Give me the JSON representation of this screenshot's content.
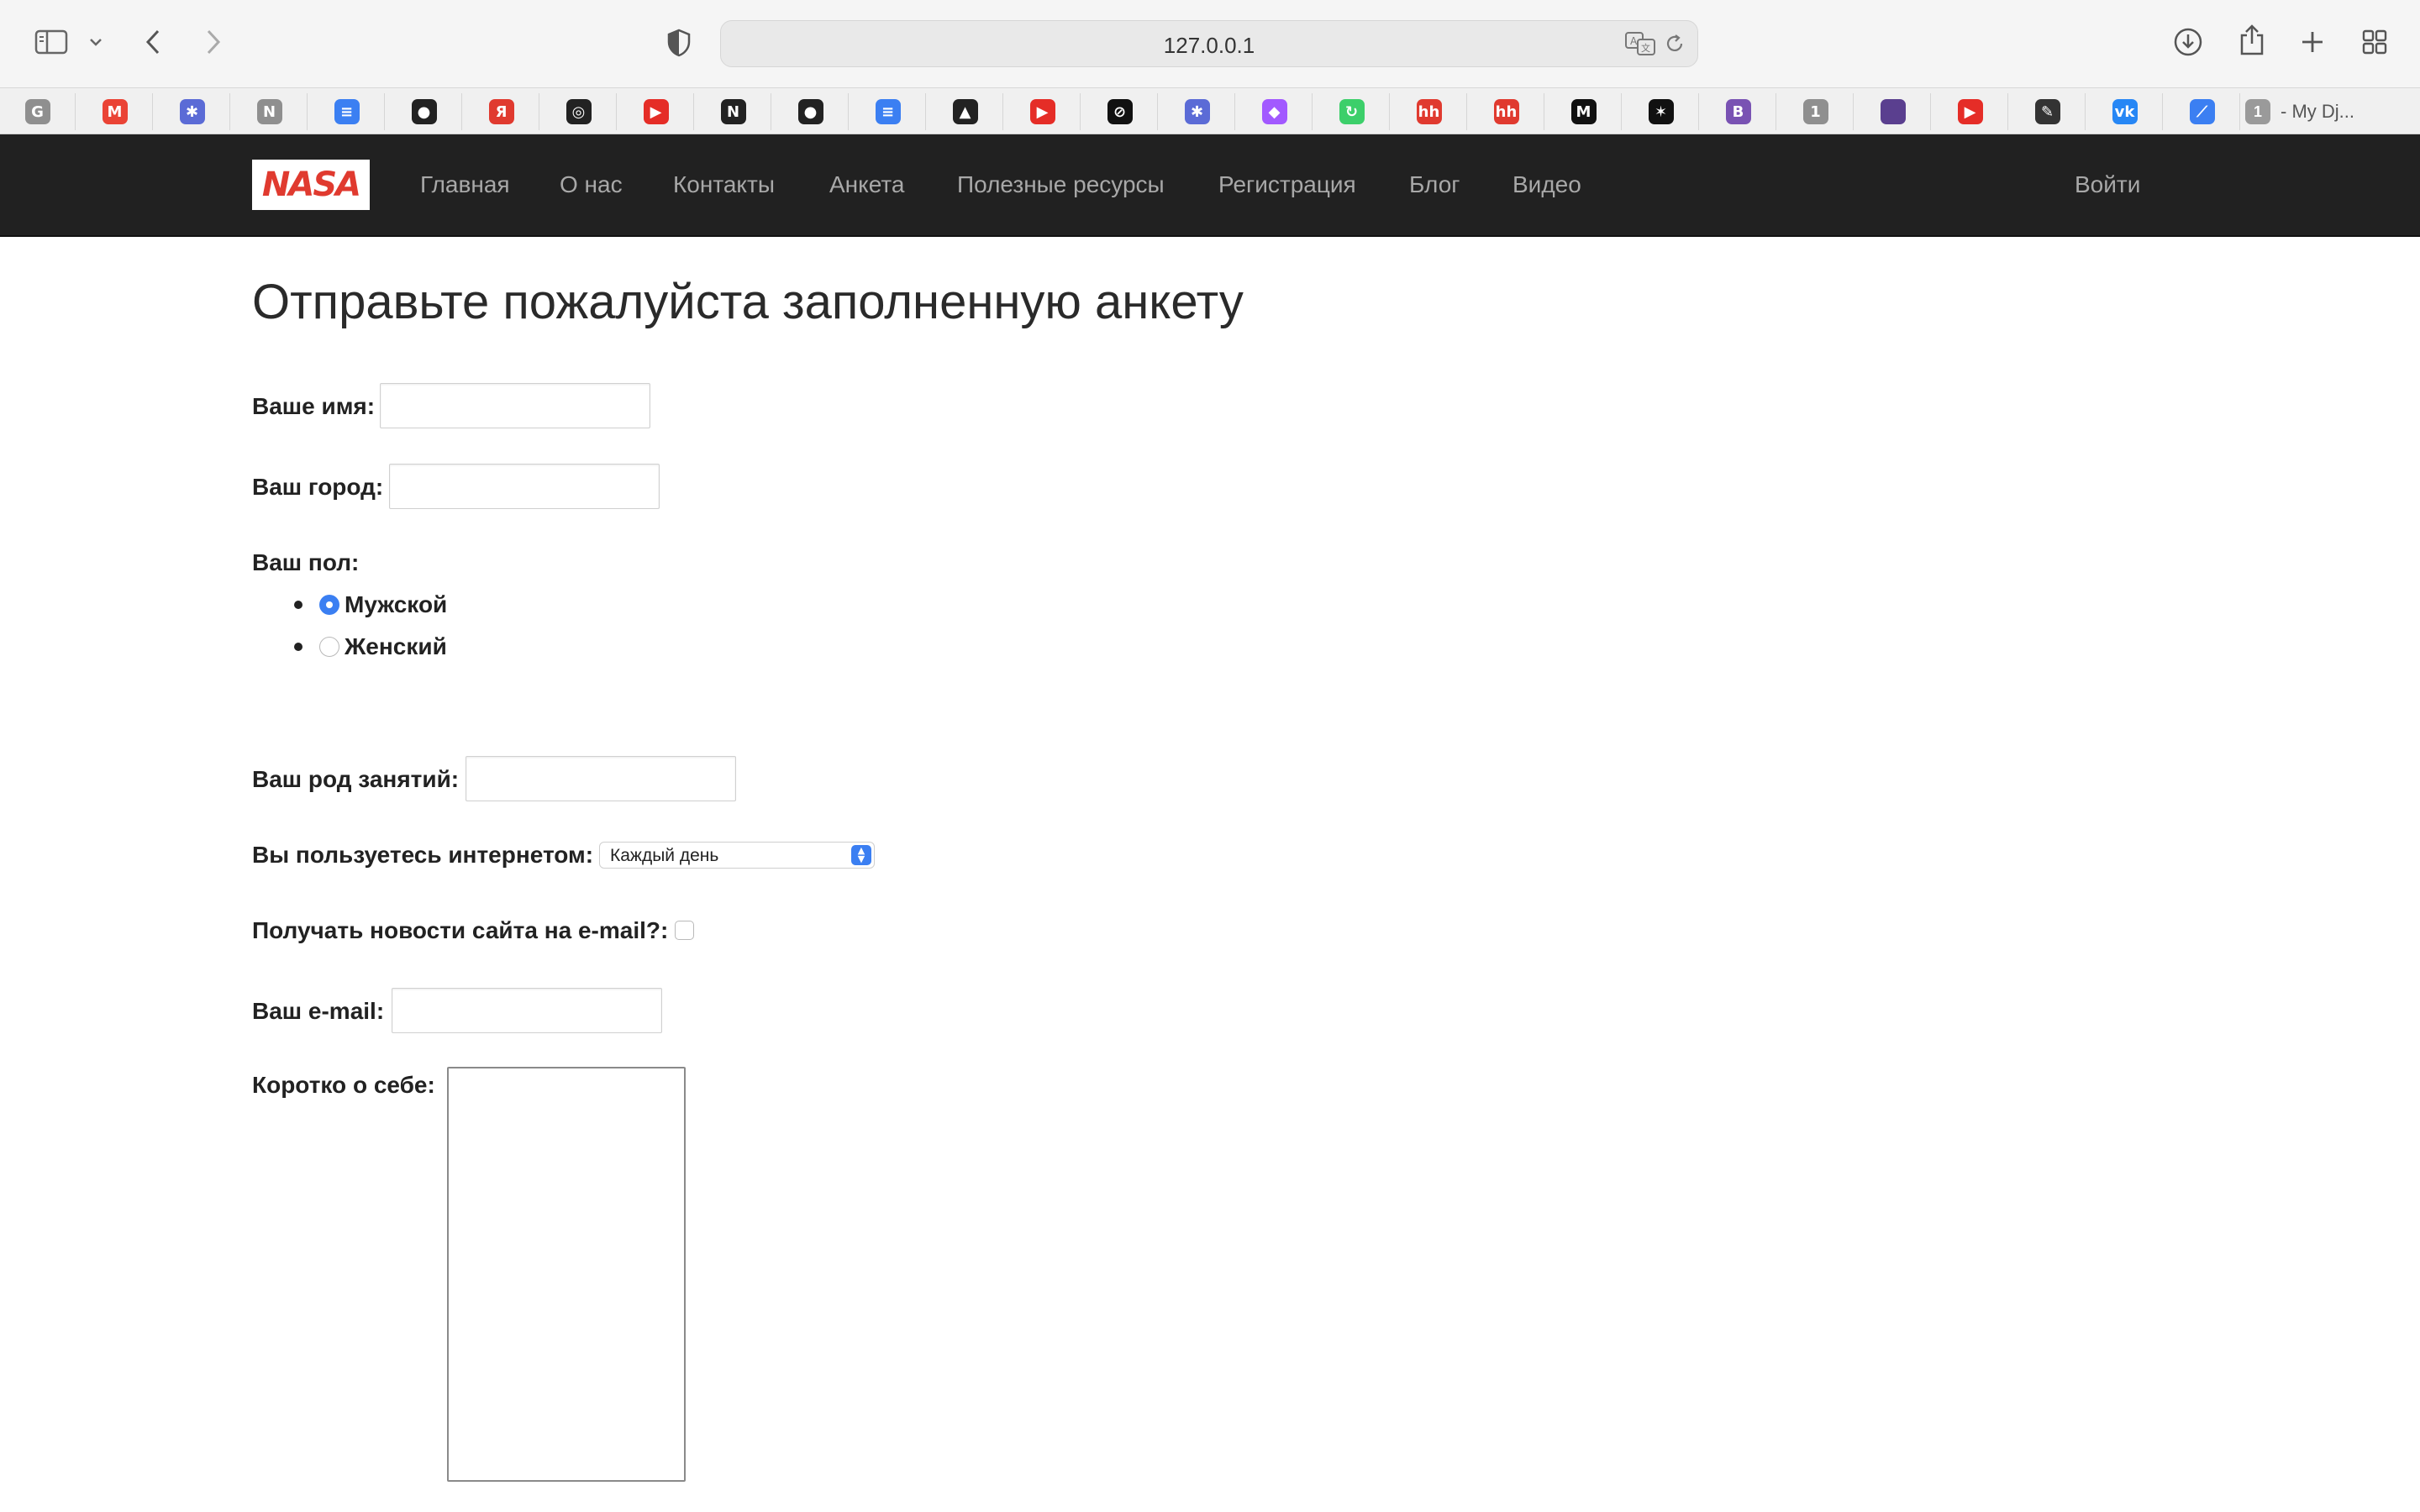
{
  "browser": {
    "url": "127.0.0.1",
    "favorites": [
      {
        "icon": "google-icon",
        "glyph": "G",
        "color": "#8f8f8f"
      },
      {
        "icon": "gmail-icon",
        "glyph": "M",
        "color": "#ea4335"
      },
      {
        "icon": "extension-icon",
        "glyph": "✱",
        "color": "#5b6bd6"
      },
      {
        "icon": "notion-n-icon",
        "glyph": "N",
        "color": "#8f8f8f"
      },
      {
        "icon": "google-docs-icon",
        "glyph": "≡",
        "color": "#3b7ff2"
      },
      {
        "icon": "github-icon",
        "glyph": "●",
        "color": "#222222"
      },
      {
        "icon": "yandex-icon",
        "glyph": "Я",
        "color": "#e03a2f"
      },
      {
        "icon": "chatgpt-icon",
        "glyph": "◎",
        "color": "#222222"
      },
      {
        "icon": "youtube-icon",
        "glyph": "▶",
        "color": "#e52d27"
      },
      {
        "icon": "notion-icon",
        "glyph": "N",
        "color": "#222222"
      },
      {
        "icon": "github-icon",
        "glyph": "●",
        "color": "#222222"
      },
      {
        "icon": "google-docs-icon",
        "glyph": "≡",
        "color": "#3b7ff2"
      },
      {
        "icon": "sailboat-icon",
        "glyph": "▲",
        "color": "#222222"
      },
      {
        "icon": "youtube-icon",
        "glyph": "▶",
        "color": "#e52d27"
      },
      {
        "icon": "link-icon",
        "glyph": "⊘",
        "color": "#111111"
      },
      {
        "icon": "extension-icon",
        "glyph": "✱",
        "color": "#5b6bd6"
      },
      {
        "icon": "figma-icon",
        "glyph": "◆",
        "color": "#a259ff"
      },
      {
        "icon": "refresh-green-icon",
        "glyph": "↻",
        "color": "#3ccf6a"
      },
      {
        "icon": "hh-icon",
        "glyph": "hh",
        "color": "#e03a2f"
      },
      {
        "icon": "hh-icon",
        "glyph": "hh",
        "color": "#e03a2f"
      },
      {
        "icon": "m-logo-icon",
        "glyph": "M",
        "color": "#111111"
      },
      {
        "icon": "kinopoisk-icon",
        "glyph": "✶",
        "color": "#111111"
      },
      {
        "icon": "bootstrap-icon",
        "glyph": "B",
        "color": "#7952b3"
      },
      {
        "icon": "number-one-icon",
        "glyph": "1",
        "color": "#8f8f8f"
      },
      {
        "icon": "purple-square-icon",
        "glyph": "",
        "color": "#5a3f8f"
      },
      {
        "icon": "youtube-icon",
        "glyph": "▶",
        "color": "#e52d27"
      },
      {
        "icon": "cat-icon",
        "glyph": "✎",
        "color": "#333333"
      },
      {
        "icon": "vk-icon",
        "glyph": "vk",
        "color": "#2787f5"
      },
      {
        "icon": "feather-icon",
        "glyph": "⟋",
        "color": "#3b7ff2"
      }
    ],
    "open_tab": {
      "icon_glyph": "1",
      "label": "- My Dj..."
    }
  },
  "site": {
    "nav": {
      "logo": "NASA",
      "items": [
        "Главная",
        "О нас",
        "Контакты",
        "Анкета",
        "Полезные ресурсы",
        "Регистрация",
        "Блог",
        "Видео"
      ],
      "login": "Войти"
    }
  },
  "form": {
    "title": "Отправьте пожалуйста заполненную анкету",
    "name_label": "Ваше имя:",
    "name_value": "",
    "city_label": "Ваш город:",
    "city_value": "",
    "gender_label": "Ваш пол:",
    "gender_options": [
      {
        "label": "Мужской",
        "checked": true
      },
      {
        "label": "Женский",
        "checked": false
      }
    ],
    "occupation_label": "Ваш род занятий:",
    "occupation_value": "",
    "internet_label": "Вы пользуетесь интернетом:",
    "internet_selected": "Каждый день",
    "news_label": "Получать новости сайта на e-mail?:",
    "news_checked": false,
    "email_label": "Ваш e-mail:",
    "email_value": "",
    "about_label": "Коротко о себе:",
    "about_value": ""
  }
}
